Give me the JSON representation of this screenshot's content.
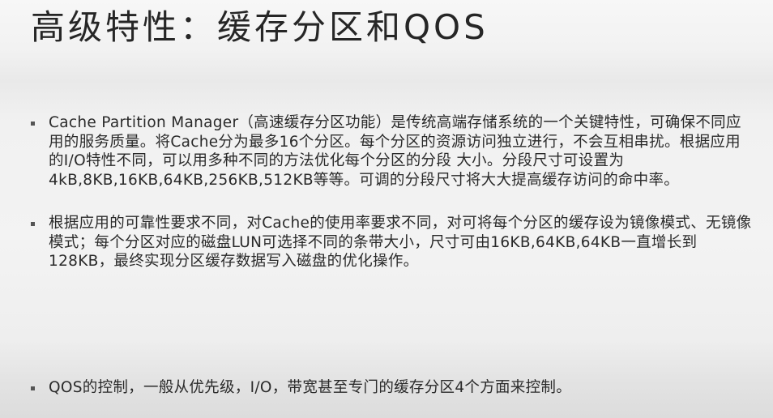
{
  "slide": {
    "title": "高级特性：缓存分区和QOS",
    "bullets": [
      {
        "text": "Cache Partition Manager（高速缓存分区功能）是传统高端存储系统的一个关键特性，可确保不同应用的服务质量。将Cache分为最多16个分区。每个分区的资源访问独立进行，不会互相串扰。根据应用的I/O特性不同，可以用多种不同的方法优化每个分区的分段 大小。分段尺寸可设置为4kB,8KB,16KB,64KB,256KB,512KB等等。可调的分段尺寸将大大提高缓存访问的命中率。"
      },
      {
        "text": "根据应用的可靠性要求不同，对Cache的使用率要求不同，对可将每个分区的缓存设为镜像模式、无镜像模式；每个分区对应的磁盘LUN可选择不同的条带大小，尺寸可由16KB,64KB,64KB一直增长到128KB，最终实现分区缓存数据写入磁盘的优化操作。"
      },
      {
        "text": "QOS的控制，一般从优先级，I/O，带宽甚至专门的缓存分区4个方面来控制。"
      }
    ]
  }
}
